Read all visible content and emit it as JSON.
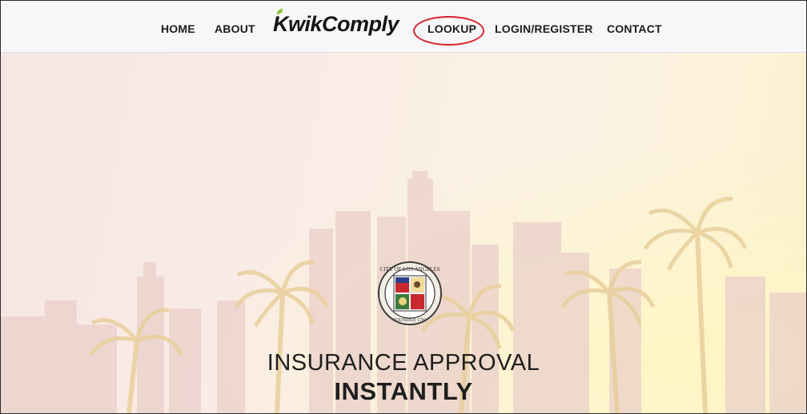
{
  "nav": {
    "home": "HOME",
    "about": "ABOUT",
    "logo_first": "K",
    "logo_rest": "wikComply",
    "lookup": "LOOKUP",
    "login_register": "LOGIN/REGISTER",
    "contact": "CONTACT"
  },
  "hero": {
    "headline_line1": "INSURANCE APPROVAL",
    "headline_line2": "INSTANTLY",
    "seal_icon": "city-of-los-angeles-seal-icon",
    "seal_top_text": "CITY OF LOS ANGELES",
    "seal_bottom_text": "FOUNDED 1781"
  },
  "colors": {
    "highlight_ring": "#d7232a",
    "logo_leaf": "#8cc63f",
    "nav_background": "#f7f7fa"
  }
}
